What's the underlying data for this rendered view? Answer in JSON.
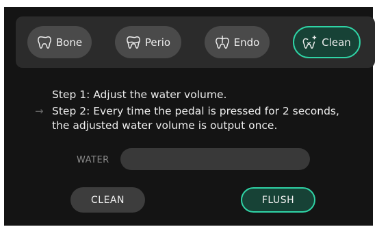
{
  "modes": [
    {
      "label": "Bone",
      "icon": "tooth-icon"
    },
    {
      "label": "Perio",
      "icon": "tooth-gum-icon"
    },
    {
      "label": "Endo",
      "icon": "tooth-file-icon"
    },
    {
      "label": "Clean",
      "icon": "tooth-sparkle-icon",
      "active": true
    }
  ],
  "steps": {
    "step1": "Step 1: Adjust the water volume.",
    "step2_line1": "Step 2: Every time the pedal is pressed for 2 seconds,",
    "step2_line2": "the adjusted water volume is output once.",
    "arrow": "→"
  },
  "water": {
    "label": "WATER"
  },
  "actions": {
    "clean": "CLEAN",
    "flush": "FLUSH"
  },
  "colors": {
    "accent": "#2fd4a6",
    "active_bg": "#174236",
    "panel": "#2b2b2b",
    "background": "#141414"
  }
}
